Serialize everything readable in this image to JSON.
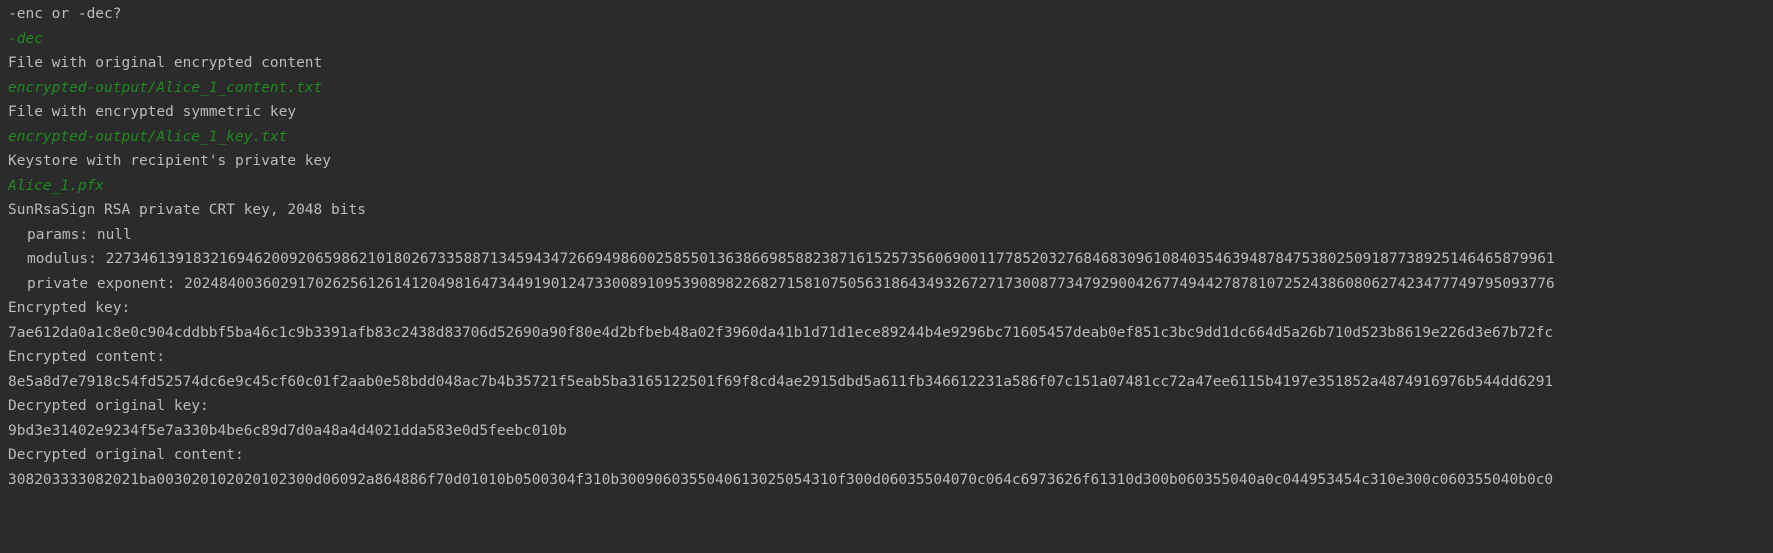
{
  "console": {
    "lines": [
      {
        "text": "-enc or -dec?",
        "kind": "output"
      },
      {
        "text": "-dec",
        "kind": "input"
      },
      {
        "text": "File with original encrypted content",
        "kind": "output"
      },
      {
        "text": "encrypted-output/Alice_1_content.txt",
        "kind": "input"
      },
      {
        "text": "File with encrypted symmetric key",
        "kind": "output"
      },
      {
        "text": "encrypted-output/Alice_1_key.txt",
        "kind": "input"
      },
      {
        "text": "Keystore with recipient's private key",
        "kind": "output"
      },
      {
        "text": "Alice_1.pfx",
        "kind": "input"
      },
      {
        "text": "SunRsaSign RSA private CRT key, 2048 bits",
        "kind": "output"
      },
      {
        "text": "params: null",
        "kind": "output",
        "indent": true
      },
      {
        "text": "modulus: 2273461391832169462009206598621018026733588713459434726694986002585501363866985882387161525735606900117785203276846830961084035463948784753802509187738925146465879961",
        "kind": "output",
        "indent": true
      },
      {
        "text": "private exponent: 2024840036029170262561261412049816473449190124733008910953908982268271581075056318643493267271730087734792900426774944278781072524386080627423477749795093776",
        "kind": "output",
        "indent": true
      },
      {
        "text": "Encrypted key:",
        "kind": "output"
      },
      {
        "text": "7ae612da0a1c8e0c904cddbbf5ba46c1c9b3391afb83c2438d83706d52690a90f80e4d2bfbeb48a02f3960da41b1d71d1ece89244b4e9296bc71605457deab0ef851c3bc9dd1dc664d5a26b710d523b8619e226d3e67b72fc",
        "kind": "output"
      },
      {
        "text": "Encrypted content:",
        "kind": "output"
      },
      {
        "text": "8e5a8d7e7918c54fd52574dc6e9c45cf60c01f2aab0e58bdd048ac7b4b35721f5eab5ba3165122501f69f8cd4ae2915dbd5a611fb346612231a586f07c151a07481cc72a47ee6115b4197e351852a4874916976b544dd6291",
        "kind": "output"
      },
      {
        "text": "Decrypted original key:",
        "kind": "output"
      },
      {
        "text": "9bd3e31402e9234f5e7a330b4be6c89d7d0a48a4d4021dda583e0d5feebc010b",
        "kind": "output"
      },
      {
        "text": "Decrypted original content:",
        "kind": "output"
      },
      {
        "text": "308203333082021ba003020102020102300d06092a864886f70d01010b0500304f310b3009060355040613025054310f300d06035504070c064c6973626f61310d300b060355040a0c044953454c310e300c060355040b0c0",
        "kind": "output"
      }
    ]
  }
}
